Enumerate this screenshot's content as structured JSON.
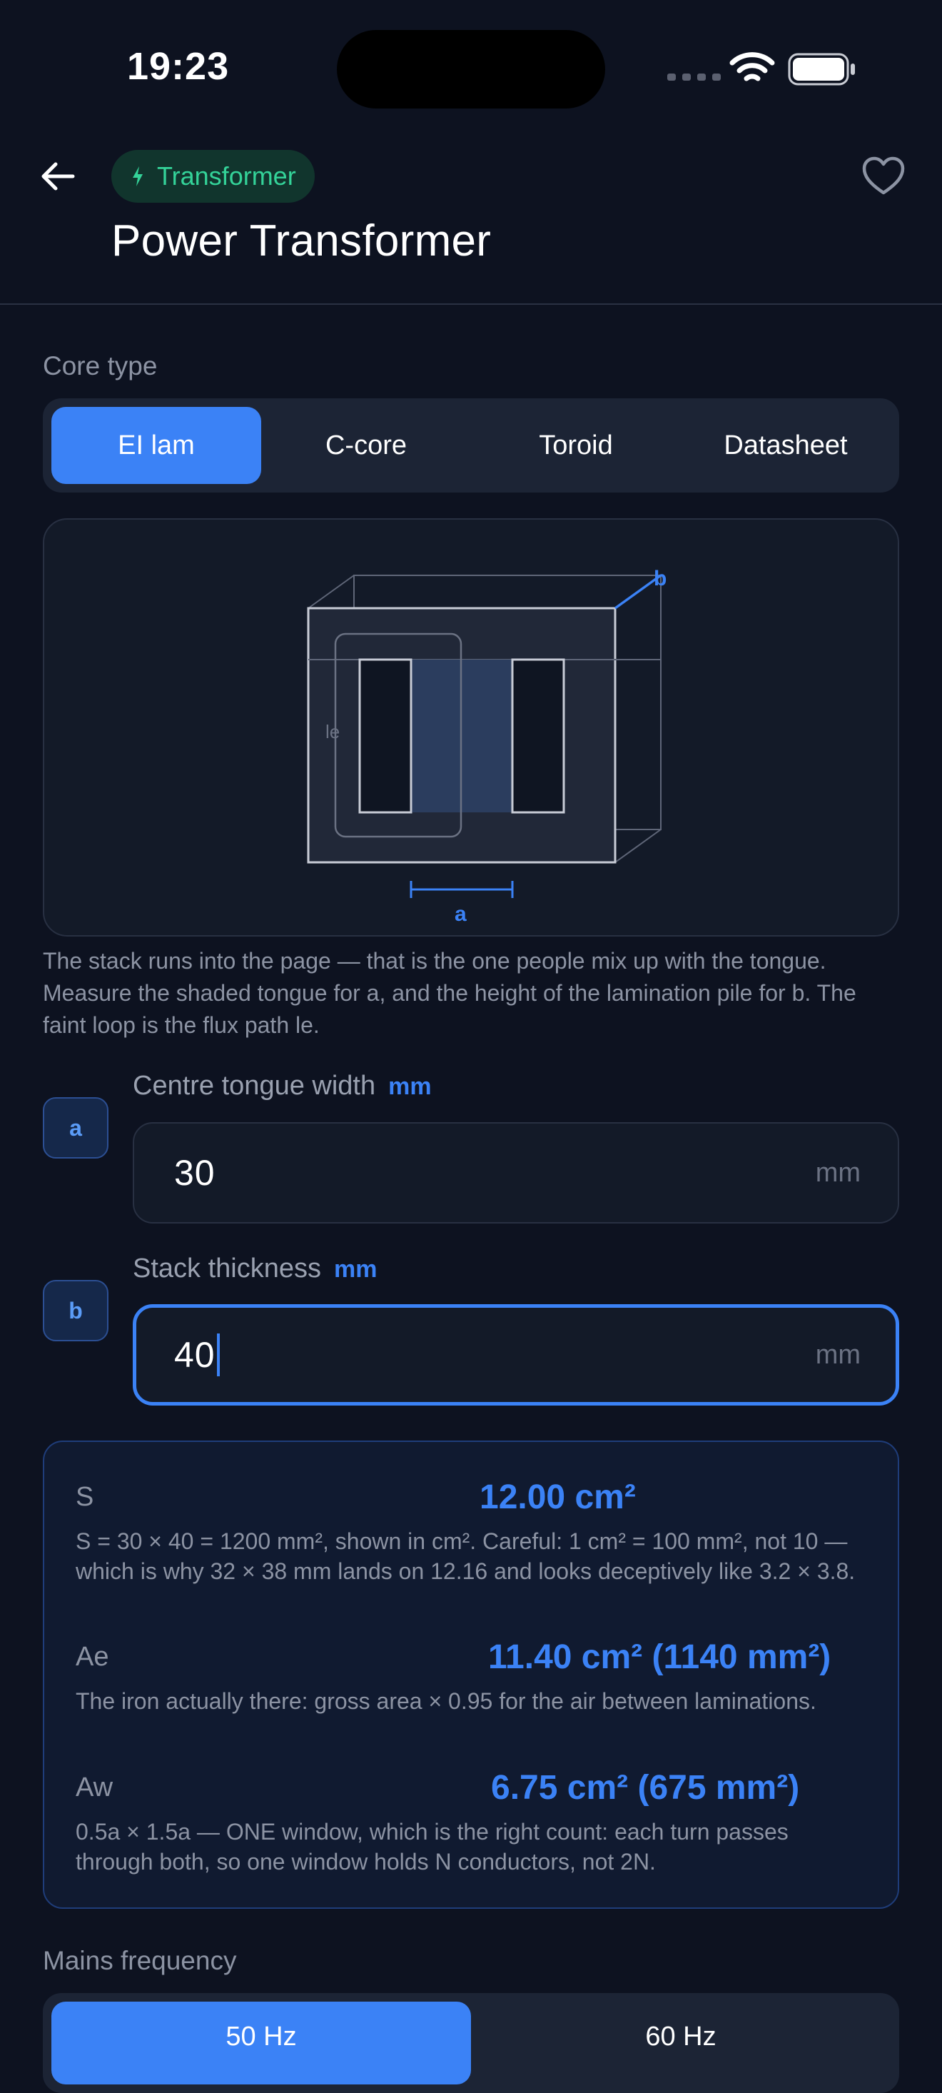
{
  "status_bar": {
    "time": "19:23"
  },
  "header": {
    "category_chip": "Transformer",
    "title": "Power Transformer"
  },
  "core_type": {
    "label": "Core type",
    "options": [
      "EI lam",
      "C-core",
      "Toroid",
      "Datasheet"
    ],
    "selected": "EI lam"
  },
  "diagram": {
    "labels": {
      "a": "a",
      "b": "b",
      "le": "le"
    },
    "explanation": "The stack runs into the page — that is the one people mix up with the tongue. Measure the shaded tongue for a, and the height of the lamination pile for b. The faint loop is the flux path le."
  },
  "inputs": [
    {
      "badge": "a",
      "label": "Centre tongue width",
      "unit_tag": "mm",
      "value": "30",
      "unit": "mm",
      "focused": false
    },
    {
      "badge": "b",
      "label": "Stack thickness",
      "unit_tag": "mm",
      "value": "40",
      "unit": "mm",
      "focused": true
    }
  ],
  "results": [
    {
      "name": "S",
      "value": "12.00 cm²",
      "description": "S = 30 × 40 = 1200 mm², shown in cm². Careful: 1 cm² = 100 mm², not 10 — which is why 32 × 38 mm lands on 12.16 and looks deceptively like 3.2 × 3.8."
    },
    {
      "name": "Ae",
      "value": "11.40 cm²  (1140 mm²)",
      "description": "The iron actually there: gross area × 0.95 for the air between laminations."
    },
    {
      "name": "Aw",
      "value": "6.75 cm²  (675 mm²)",
      "description": "0.5a × 1.5a — ONE window, which is the right count: each turn passes through both, so one window holds N conductors, not 2N."
    }
  ],
  "mains_frequency": {
    "label": "Mains frequency",
    "options": [
      "50 Hz",
      "60 Hz"
    ],
    "selected": "50 Hz"
  },
  "colors": {
    "background": "#0d1220",
    "accent": "#3b82f6",
    "chip_green": "#34d399"
  }
}
